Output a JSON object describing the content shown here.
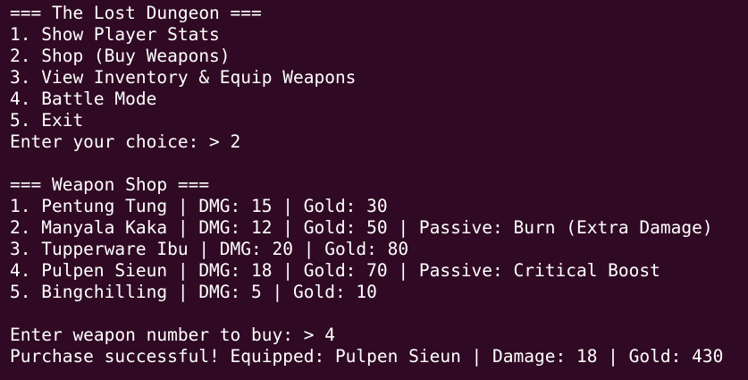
{
  "terminal": {
    "colors": {
      "background": "#300a24",
      "foreground": "#ffffff"
    },
    "lines": [
      "=== The Lost Dungeon ===",
      "1. Show Player Stats",
      "2. Shop (Buy Weapons)",
      "3. View Inventory & Equip Weapons",
      "4. Battle Mode",
      "5. Exit",
      "Enter your choice: > 2",
      "",
      "=== Weapon Shop ===",
      "1. Pentung Tung | DMG: 15 | Gold: 30",
      "2. Manyala Kaka | DMG: 12 | Gold: 50 | Passive: Burn (Extra Damage)",
      "3. Tupperware Ibu | DMG: 20 | Gold: 80",
      "4. Pulpen Sieun | DMG: 18 | Gold: 70 | Passive: Critical Boost",
      "5. Bingchilling | DMG: 5 | Gold: 10",
      "",
      "Enter weapon number to buy: > 4",
      "Purchase successful! Equipped: Pulpen Sieun | Damage: 18 | Gold: 430"
    ]
  }
}
